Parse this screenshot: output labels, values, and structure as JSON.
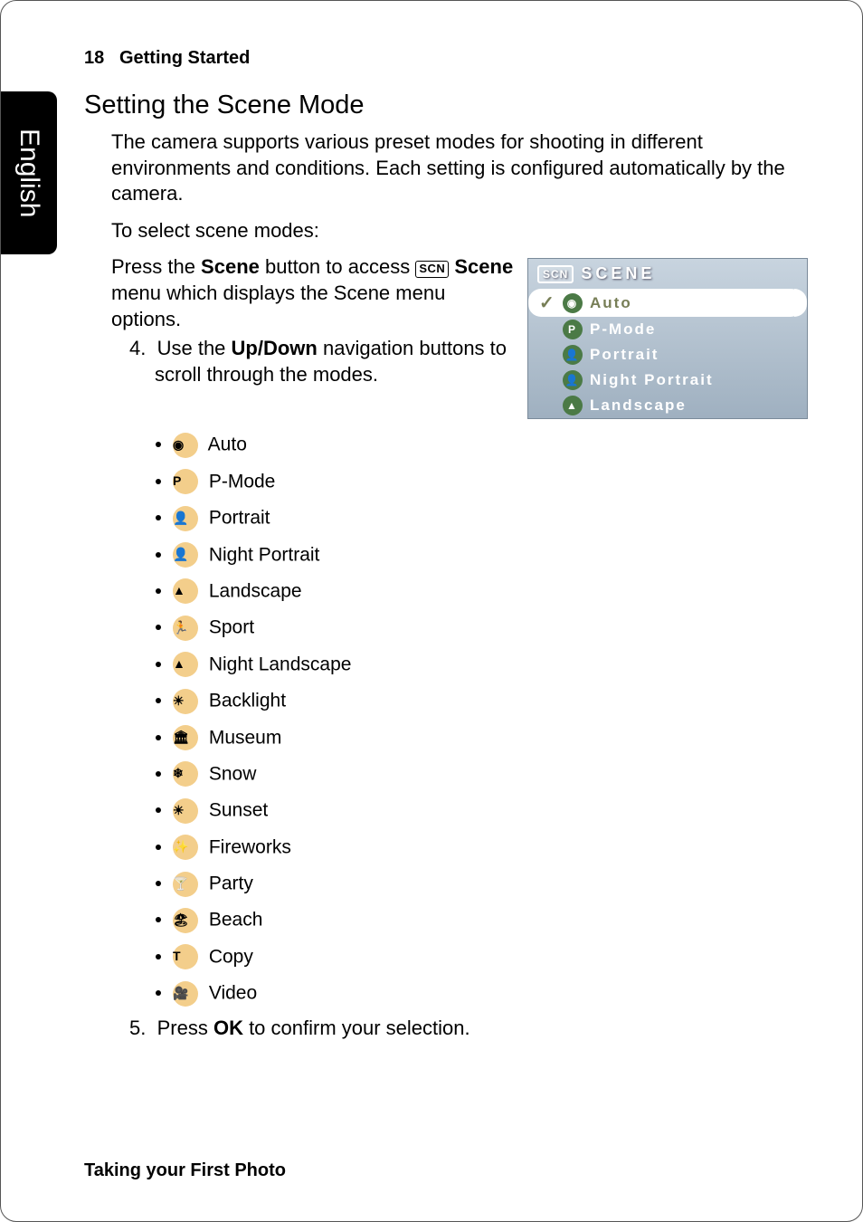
{
  "side_tab": "English",
  "header": {
    "page_num": "18",
    "chapter": "Getting Started"
  },
  "section_title": "Setting the Scene Mode",
  "intro_para": "The camera supports various preset modes for shooting in different environments and conditions. Each setting is configured automatically by the camera.",
  "select_para": "To select scene modes:",
  "press_prefix": "Press the ",
  "press_bold1": "Scene",
  "press_mid": " button to access ",
  "press_scn": "SCN",
  "press_bold2": " Scene",
  "press_suffix": " menu which displays the Scene menu options.",
  "step4_num": "4.",
  "step4_text_prefix": "Use the ",
  "step4_bold": "Up/Down",
  "step4_text_suffix": " navigation buttons to scroll through the modes.",
  "modes": [
    {
      "name": "auto-icon",
      "glyph": "◉",
      "label": "Auto"
    },
    {
      "name": "pmode-icon",
      "glyph": "P",
      "label": "P-Mode"
    },
    {
      "name": "portrait-icon",
      "glyph": "👤",
      "label": "Portrait"
    },
    {
      "name": "night-portrait-icon",
      "glyph": "👤",
      "label": "Night Portrait"
    },
    {
      "name": "landscape-icon",
      "glyph": "▲",
      "label": "Landscape"
    },
    {
      "name": "sport-icon",
      "glyph": "🏃",
      "label": "Sport"
    },
    {
      "name": "night-landscape-icon",
      "glyph": "▲",
      "label": "Night Landscape"
    },
    {
      "name": "backlight-icon",
      "glyph": "☀",
      "label": "Backlight"
    },
    {
      "name": "museum-icon",
      "glyph": "🏛",
      "label": "Museum"
    },
    {
      "name": "snow-icon",
      "glyph": "❄",
      "label": "Snow"
    },
    {
      "name": "sunset-icon",
      "glyph": "☀",
      "label": "Sunset"
    },
    {
      "name": "fireworks-icon",
      "glyph": "✨",
      "label": "Fireworks"
    },
    {
      "name": "party-icon",
      "glyph": "🍸",
      "label": "Party"
    },
    {
      "name": "beach-icon",
      "glyph": "🏖",
      "label": "Beach"
    },
    {
      "name": "copy-icon",
      "glyph": "T",
      "label": "Copy"
    },
    {
      "name": "video-icon",
      "glyph": "🎥",
      "label": "Video"
    }
  ],
  "step5_num": "5.",
  "step5_prefix": "Press ",
  "step5_bold": "OK",
  "step5_suffix": " to confirm your selection.",
  "scene_menu": {
    "badge": "SCN",
    "title": "SCENE",
    "items": [
      {
        "glyph": "◉",
        "label": "Auto",
        "selected": true
      },
      {
        "glyph": "P",
        "label": "P-Mode",
        "selected": false
      },
      {
        "glyph": "👤",
        "label": "Portrait",
        "selected": false
      },
      {
        "glyph": "👤",
        "label": "Night Portrait",
        "selected": false
      },
      {
        "glyph": "▲",
        "label": "Landscape",
        "selected": false
      }
    ]
  },
  "footer": "Taking your First Photo"
}
